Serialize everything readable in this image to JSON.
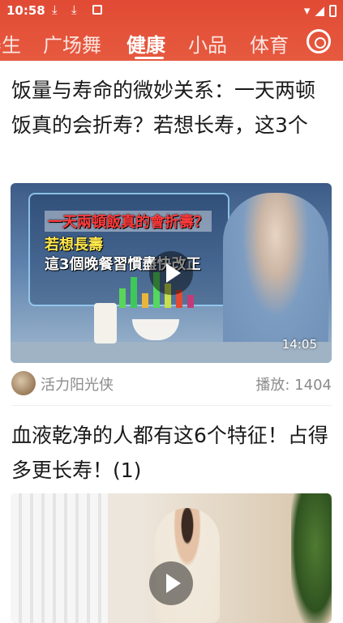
{
  "status_bar": {
    "time": "10:58",
    "icons": [
      "download-icon",
      "download-icon",
      "app-notification-icon",
      "wifi-icon",
      "signal-icon",
      "battery-icon"
    ]
  },
  "tabs": [
    {
      "label": "养生",
      "visible_text": "养生"
    },
    {
      "label": "广场舞"
    },
    {
      "label": "健康",
      "active": true
    },
    {
      "label": "小品"
    },
    {
      "label": "体育"
    }
  ],
  "accent_color": "#e14a34",
  "feed": [
    {
      "title": "饭量与寿命的微妙关系：一天两顿饭真的会折寿？若想长寿，这3个",
      "thumbnail_text": [
        "一天兩頓飯真的會折壽？",
        "若想長壽",
        "這3個晚餐習慣盡快改正"
      ],
      "duration": "14:05",
      "author": "活力阳光侠",
      "plays": "播放: 1404"
    },
    {
      "title": "血液乾净的人都有这6个特征！占得多更长寿！(1)"
    }
  ]
}
